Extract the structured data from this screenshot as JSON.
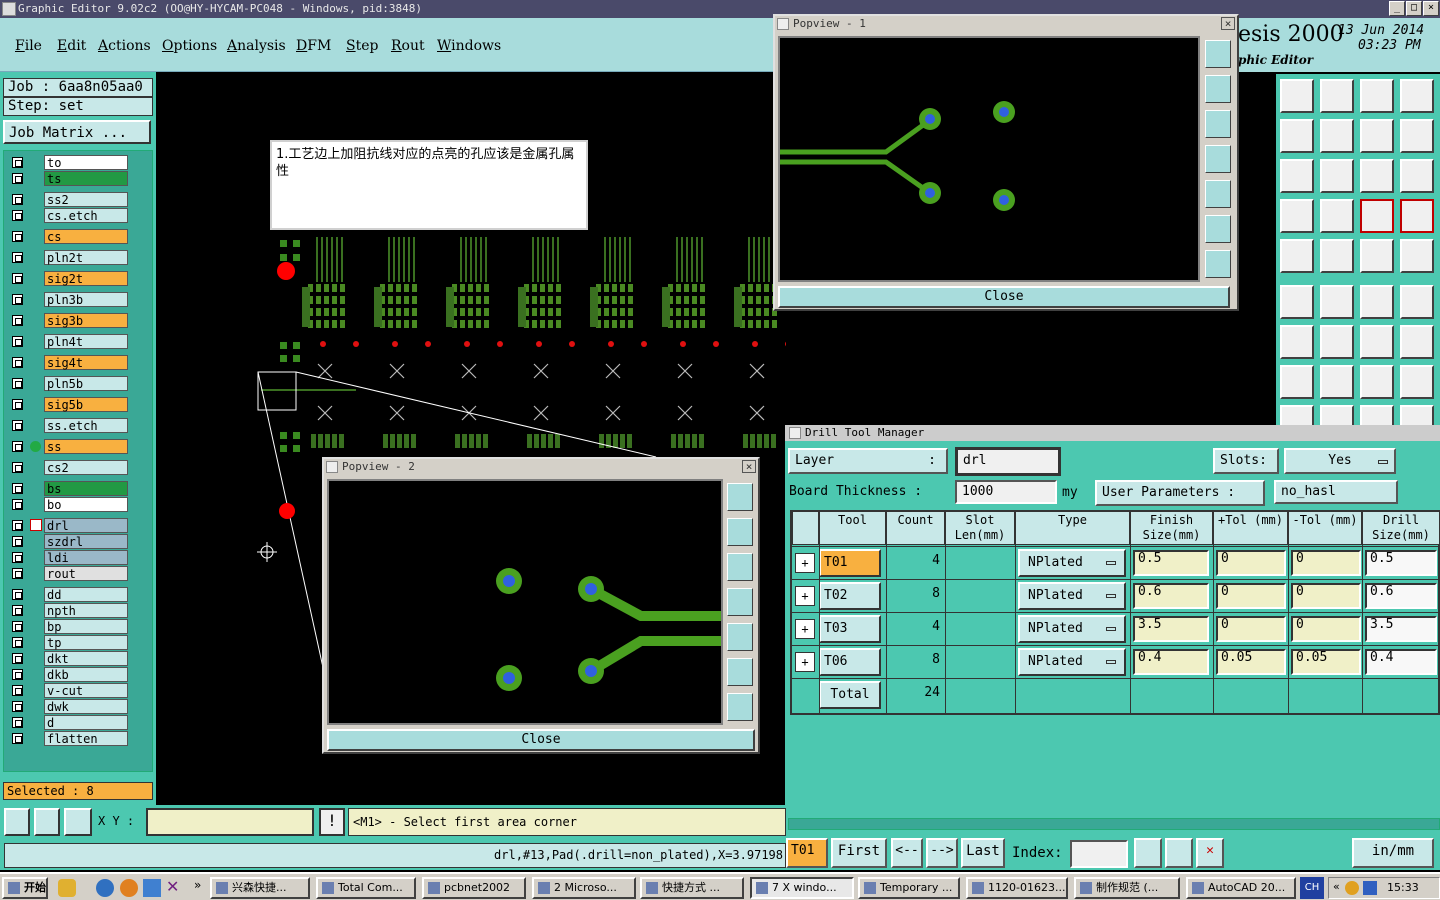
{
  "window": {
    "title": "Graphic Editor 9.02c2 (OO@HY-HYCAM-PC048 - Windows, pid:3848)"
  },
  "menu": [
    "File",
    "Edit",
    "Actions",
    "Options",
    "Analysis",
    "DFM",
    "Step",
    "Rout",
    "Windows"
  ],
  "brand": {
    "name": "esis 2000",
    "subtitle": "phic Editor",
    "date": "13 Jun 2014",
    "time": "03:23 PM"
  },
  "job": {
    "job": "Job : 6aa8n05aa0",
    "step": "Step: set",
    "matrix": "Job Matrix ..."
  },
  "layers": [
    "to",
    "ts",
    "ss2",
    "cs.etch",
    "cs",
    "pln2t",
    "sig2t",
    "pln3b",
    "sig3b",
    "pln4t",
    "sig4t",
    "pln5b",
    "sig5b",
    "ss.etch",
    "ss",
    "cs2",
    "bs",
    "bo",
    "drl",
    "szdrl",
    "ldi",
    "rout",
    "dd",
    "npth",
    "bp",
    "tp",
    "dkt",
    "dkb",
    "v-cut",
    "dwk",
    "d",
    "flatten"
  ],
  "selected": "Selected : 8",
  "note": "1.工艺边上加阻抗线对应的点亮的孔应该是金属孔属性",
  "popview1": {
    "title": "Popview - 1",
    "close": "Close"
  },
  "popview2": {
    "title": "Popview - 2",
    "close": "Close"
  },
  "coords": {
    "label": "X Y :",
    "prompt": "<M1> - Select first area corner",
    "status": "drl,#13,Pad(.drill=non_plated),X=3.97198"
  },
  "dtm": {
    "title": "Drill Tool Manager",
    "layer_label": "Layer",
    "layer_value": "drl",
    "slots_label": "Slots:",
    "slots_value": "Yes",
    "board_label": "Board Thickness :",
    "board_value": "1000",
    "board_unit": "my",
    "user_label": "User Parameters :",
    "user_value": "no_hasl",
    "headers": [
      "Tool",
      "Count",
      "Slot Len(mm)",
      "Type",
      "Finish Size(mm)",
      "+Tol (mm)",
      "-Tol (mm)",
      "Drill Size(mm)"
    ],
    "rows": [
      {
        "tool": "T01",
        "count": "4",
        "type": "NPlated",
        "finish": "0.5",
        "ptol": "0",
        "ntol": "0",
        "drill": "0.5"
      },
      {
        "tool": "T02",
        "count": "8",
        "type": "NPlated",
        "finish": "0.6",
        "ptol": "0",
        "ntol": "0",
        "drill": "0.6"
      },
      {
        "tool": "T03",
        "count": "4",
        "type": "NPlated",
        "finish": "3.5",
        "ptol": "0",
        "ntol": "0",
        "drill": "3.5"
      },
      {
        "tool": "T06",
        "count": "8",
        "type": "NPlated",
        "finish": "0.4",
        "ptol": "0.05",
        "ntol": "0.05",
        "drill": "0.4"
      }
    ],
    "total_label": "Total",
    "total_count": "24",
    "current": "T01",
    "first": "First",
    "prev": "<--",
    "next": "-->",
    "last": "Last",
    "index_label": "Index:",
    "units": "in/mm"
  },
  "taskbar": {
    "start": "开始",
    "tasks": [
      "兴森快捷...",
      "Total Com...",
      "pcbnet2002",
      "2 Microso...",
      "快捷方式 ...",
      "7 X windo...",
      "Temporary ...",
      "1120-01623...",
      "制作规范 (...",
      "AutoCAD 20..."
    ],
    "lang": "CH",
    "clock": "15:33"
  },
  "colors": {
    "teal": "#4cc8b0",
    "panel": "#a8dcdc",
    "field": "#c8e8e8",
    "orange": "#f8b040",
    "green": "#229944",
    "trace": "#4aa020",
    "drill": "#3060e0"
  }
}
